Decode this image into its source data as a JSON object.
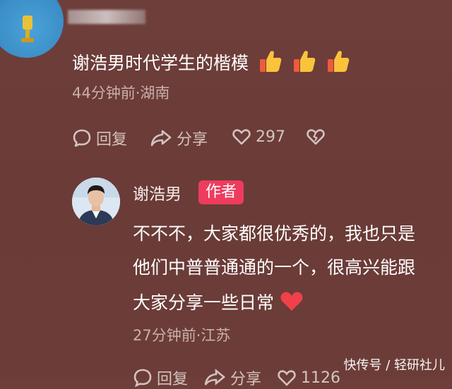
{
  "comment1": {
    "text": "谢浩男时代学生的楷模",
    "meta": "44分钟前·湖南",
    "reply_label": "回复",
    "share_label": "分享",
    "like_count": "297"
  },
  "reply": {
    "author_name": "谢浩男",
    "author_badge": "作者",
    "lines": [
      "不不不，大家都很优秀的，我也只是",
      "他们中普普通通的一个，很高兴能跟",
      "大家分享一些日常"
    ],
    "meta": "27分钟前·江苏",
    "reply_label": "回复",
    "share_label": "分享",
    "like_count": "1126"
  },
  "watermark": "快传号 / 轻研社儿",
  "colors": {
    "background": "#6c3d38",
    "badge": "#ee3c5f",
    "meta_text": "#c9b0ab",
    "heart": "#f0414a"
  },
  "icons": [
    "reply-bubble-icon",
    "share-arrow-icon",
    "like-heart-icon",
    "dislike-broken-heart-icon",
    "thumbs-up-emoji-icon",
    "red-heart-emoji-icon"
  ]
}
